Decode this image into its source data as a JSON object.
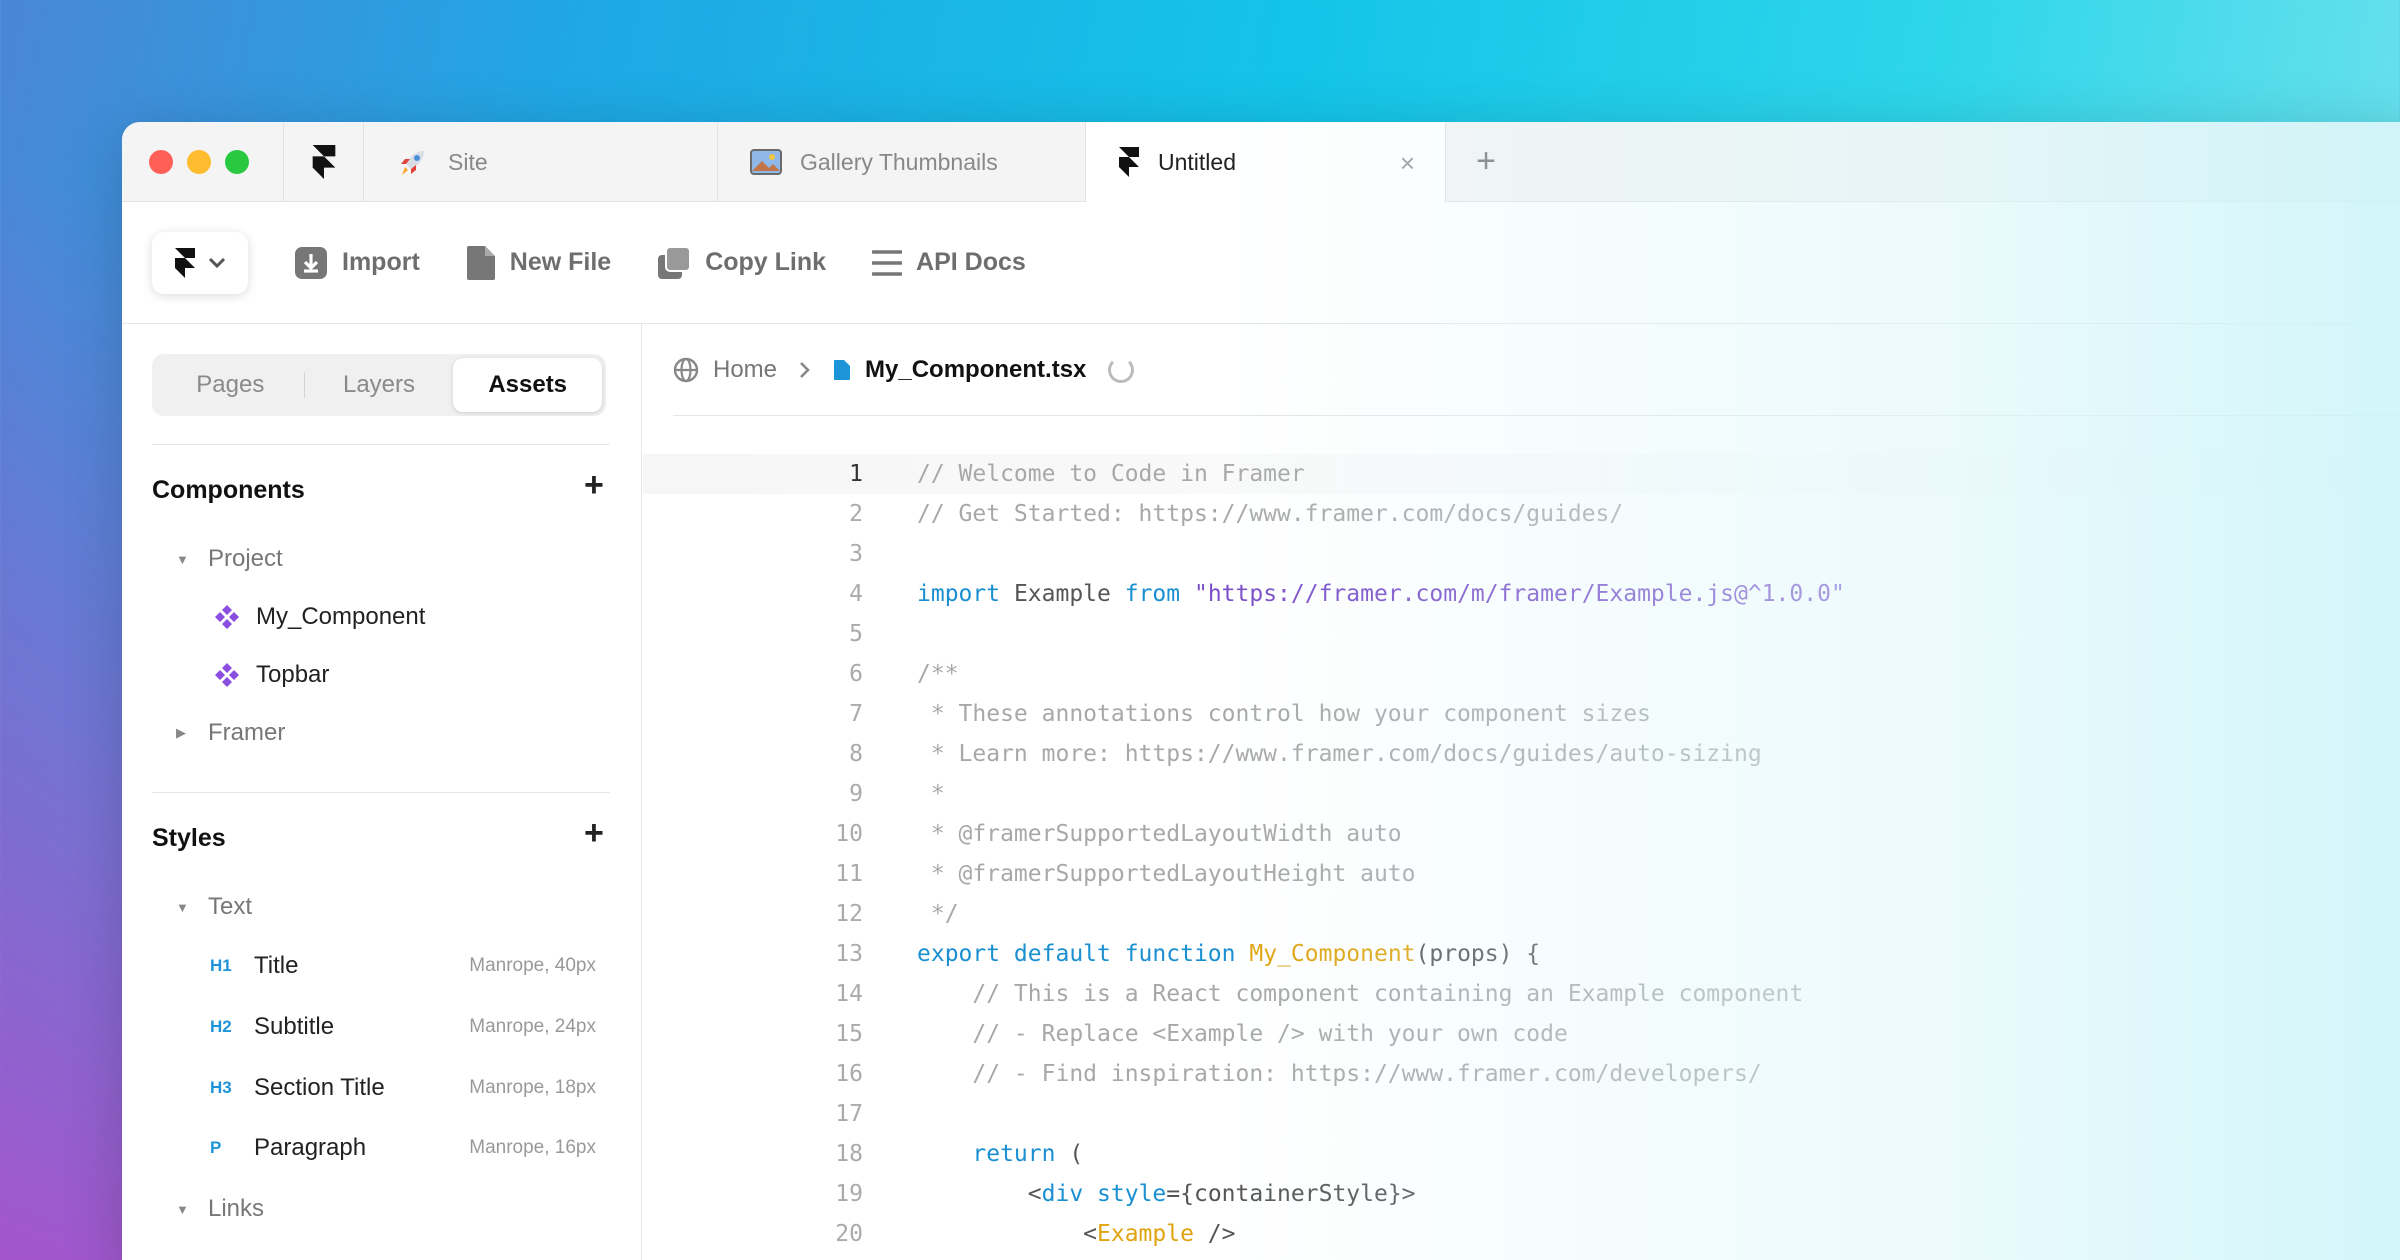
{
  "tabs": {
    "site": "Site",
    "gallery": "Gallery Thumbnails",
    "untitled": "Untitled",
    "close_glyph": "×",
    "add_glyph": "+"
  },
  "toolbar": {
    "import": "Import",
    "new_file": "New File",
    "copy_link": "Copy Link",
    "api_docs": "API Docs"
  },
  "sidebar": {
    "segments": [
      "Pages",
      "Layers",
      "Assets"
    ],
    "active_segment": "Assets",
    "components": {
      "title": "Components",
      "groups": [
        {
          "label": "Project",
          "items": [
            "My_Component",
            "Topbar"
          ]
        },
        {
          "label": "Framer",
          "items": []
        }
      ]
    },
    "styles": {
      "title": "Styles",
      "text_group": "Text",
      "items": [
        {
          "badge": "H1",
          "label": "Title",
          "meta": "Manrope, 40px"
        },
        {
          "badge": "H2",
          "label": "Subtitle",
          "meta": "Manrope, 24px"
        },
        {
          "badge": "H3",
          "label": "Section Title",
          "meta": "Manrope, 18px"
        },
        {
          "badge": "P",
          "label": "Paragraph",
          "meta": "Manrope, 16px"
        }
      ],
      "links_group": "Links"
    }
  },
  "breadcrumb": {
    "home": "Home",
    "file": "My_Component.tsx"
  },
  "code_lines": [
    {
      "n": "1",
      "parts": [
        [
          "c",
          "// Welcome to Code in Framer"
        ]
      ]
    },
    {
      "n": "2",
      "parts": [
        [
          "c",
          "// Get Started: https://www.framer.com/docs/guides/"
        ]
      ]
    },
    {
      "n": "3",
      "parts": []
    },
    {
      "n": "4",
      "parts": [
        [
          "k",
          "import"
        ],
        [
          "t",
          " Example "
        ],
        [
          "k",
          "from"
        ],
        [
          "t",
          " "
        ],
        [
          "s",
          "\"https://framer.com/m/framer/Example.js@^1.0.0\""
        ]
      ]
    },
    {
      "n": "5",
      "parts": []
    },
    {
      "n": "6",
      "parts": [
        [
          "c",
          "/**"
        ]
      ]
    },
    {
      "n": "7",
      "parts": [
        [
          "c",
          " * These annotations control how your component sizes"
        ]
      ]
    },
    {
      "n": "8",
      "parts": [
        [
          "c",
          " * Learn more: https://www.framer.com/docs/guides/auto-sizing"
        ]
      ]
    },
    {
      "n": "9",
      "parts": [
        [
          "c",
          " *"
        ]
      ]
    },
    {
      "n": "10",
      "parts": [
        [
          "c",
          " * @framerSupportedLayoutWidth auto"
        ]
      ]
    },
    {
      "n": "11",
      "parts": [
        [
          "c",
          " * @framerSupportedLayoutHeight auto"
        ]
      ]
    },
    {
      "n": "12",
      "parts": [
        [
          "c",
          " */"
        ]
      ]
    },
    {
      "n": "13",
      "parts": [
        [
          "k",
          "export default function"
        ],
        [
          "t",
          " "
        ],
        [
          "f",
          "My_Component"
        ],
        [
          "t",
          "(props) {"
        ]
      ]
    },
    {
      "n": "14",
      "parts": [
        [
          "c",
          "    // This is a React component containing an Example component"
        ]
      ]
    },
    {
      "n": "15",
      "parts": [
        [
          "c",
          "    // - Replace <Example /> with your own code"
        ]
      ]
    },
    {
      "n": "16",
      "parts": [
        [
          "c",
          "    // - Find inspiration: https://www.framer.com/developers/"
        ]
      ]
    },
    {
      "n": "17",
      "parts": []
    },
    {
      "n": "18",
      "parts": [
        [
          "t",
          "    "
        ],
        [
          "k",
          "return"
        ],
        [
          "t",
          " ("
        ]
      ]
    },
    {
      "n": "19",
      "parts": [
        [
          "t",
          "        <"
        ],
        [
          "k",
          "div"
        ],
        [
          "t",
          " "
        ],
        [
          "k",
          "style"
        ],
        [
          "t",
          "={containerStyle}>"
        ]
      ]
    },
    {
      "n": "20",
      "parts": [
        [
          "t",
          "            <"
        ],
        [
          "f",
          "Example"
        ],
        [
          "t",
          " />"
        ]
      ]
    }
  ],
  "colors": {
    "comment": "#a8a8a8",
    "keyword": "#1a8fd1",
    "string": "#7b4fc9",
    "function": "#e0a410",
    "component_icon": "#8a4fe0",
    "heading_badge": "#1e94d8"
  }
}
